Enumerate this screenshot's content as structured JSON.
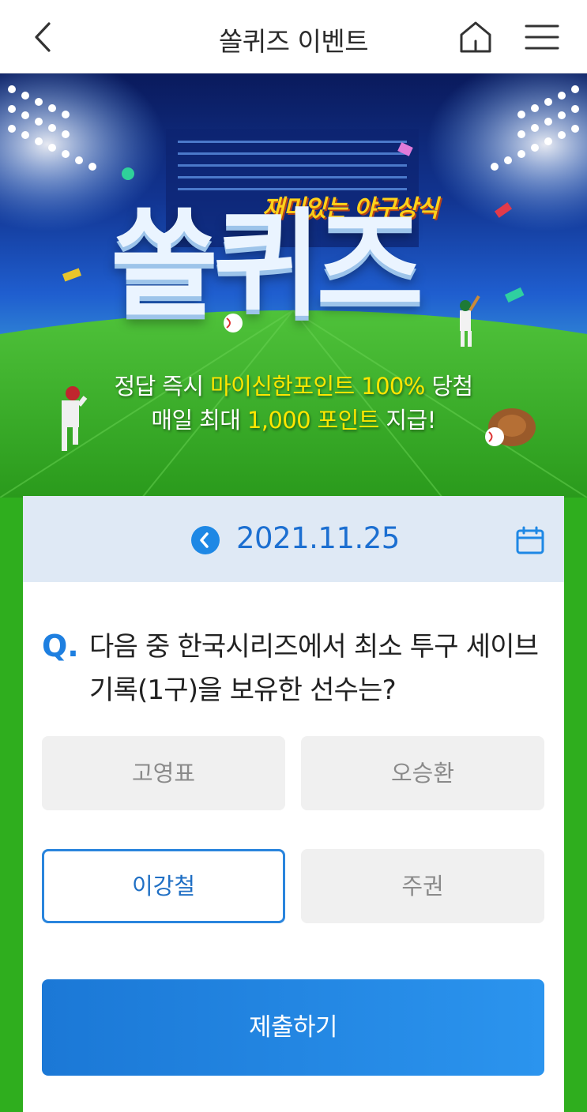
{
  "header": {
    "title": "쏠퀴즈 이벤트",
    "back_icon": "chevron-left-icon",
    "home_icon": "home-icon",
    "menu_icon": "hamburger-menu-icon"
  },
  "banner": {
    "subtitle": "재미있는 야구상식",
    "logo": "쏠퀴즈",
    "line1_prefix": "정답 즉시 ",
    "line1_highlight": "마이신한포인트 100%",
    "line1_suffix": " 당첨",
    "line2_prefix": "매일 최대 ",
    "line2_highlight": "1,000 포인트",
    "line2_suffix": " 지급!"
  },
  "quiz": {
    "date": "2021.11.25",
    "q_mark": "Q.",
    "question": "다음 중 한국시리즈에서 최소 투구 세이브 기록(1구)을 보유한 선수는?",
    "options": [
      {
        "label": "고영표",
        "selected": false
      },
      {
        "label": "오승환",
        "selected": false
      },
      {
        "label": "이강철",
        "selected": true
      },
      {
        "label": "주권",
        "selected": false
      }
    ],
    "submit_label": "제출하기"
  },
  "colors": {
    "accent": "#1e88e5",
    "background_green": "#2fae1e",
    "highlight_yellow": "#ffe600"
  }
}
